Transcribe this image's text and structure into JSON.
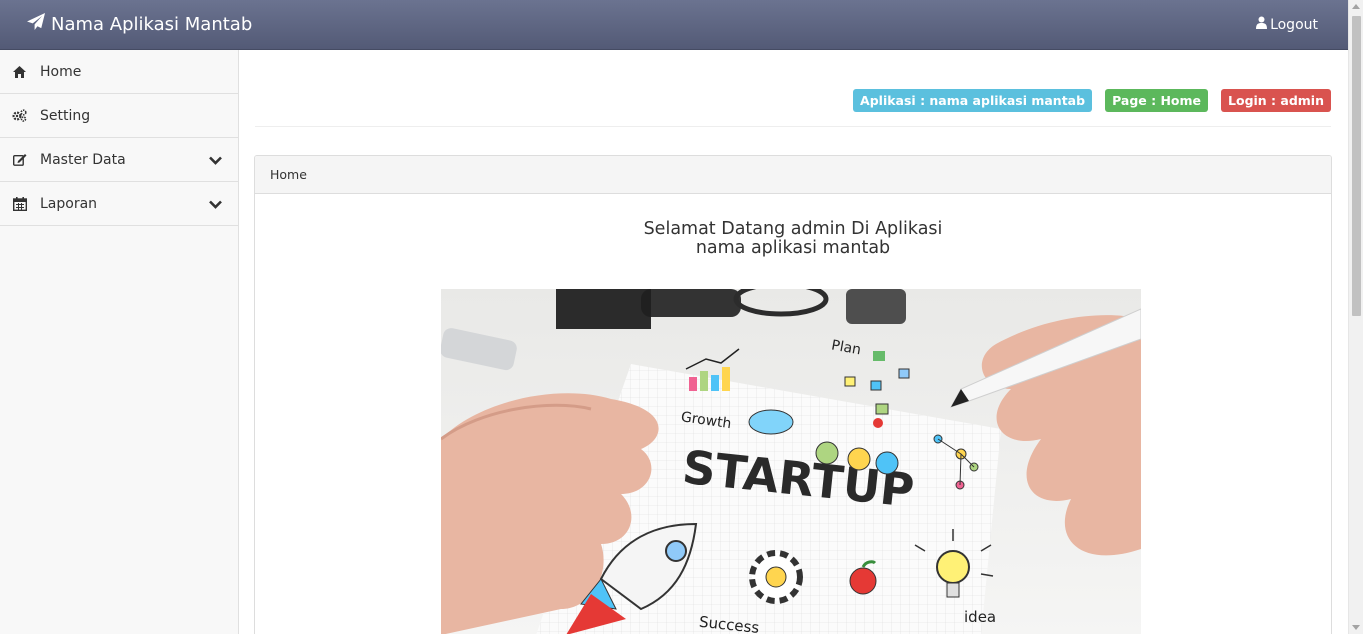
{
  "app": {
    "title": "Nama Aplikasi Mantab"
  },
  "header": {
    "logout_label": "Logout"
  },
  "sidebar": {
    "items": [
      {
        "label": "Home",
        "icon": "home-icon"
      },
      {
        "label": "Setting",
        "icon": "gears-icon"
      },
      {
        "label": "Master Data",
        "icon": "edit-icon",
        "expandable": true
      },
      {
        "label": "Laporan",
        "icon": "calendar-icon",
        "expandable": true
      }
    ]
  },
  "badges": {
    "app": "Aplikasi : nama aplikasi mantab",
    "page": "Page : Home",
    "login": "Login : admin"
  },
  "panel": {
    "heading": "Home",
    "welcome_line1": "Selamat Datang admin Di Aplikasi",
    "welcome_line2": "nama aplikasi mantab"
  },
  "hero": {
    "text_startup": "STARTUP",
    "text_plan": "Plan",
    "text_growth": "Growth",
    "text_success": "Success",
    "text_idea": "idea"
  },
  "colors": {
    "navbar": "#5f6683",
    "badge_info": "#5bc0de",
    "badge_success": "#5cb85c",
    "badge_danger": "#d9534f"
  }
}
